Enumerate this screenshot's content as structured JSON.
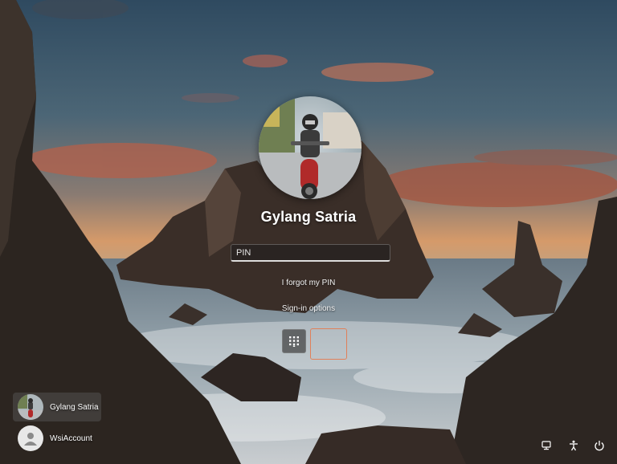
{
  "user": {
    "name": "Gylang Satria"
  },
  "pin": {
    "placeholder": "PIN",
    "value": ""
  },
  "links": {
    "forgot": "I forgot my PIN",
    "signin_options": "Sign-in options"
  },
  "signin_methods": [
    {
      "name": "PIN keypad",
      "icon": "keypad-icon"
    },
    {
      "name": "selected option",
      "icon": ""
    }
  ],
  "users": [
    {
      "name": "Gylang Satria",
      "icon": "user-photo"
    },
    {
      "name": "WsiAccount",
      "icon": "person-icon"
    }
  ],
  "system_buttons": [
    {
      "name": "network",
      "icon": "network-icon"
    },
    {
      "name": "accessibility",
      "icon": "accessibility-icon"
    },
    {
      "name": "power",
      "icon": "power-icon"
    }
  ],
  "colors": {
    "focus_outline": "#e0805a"
  }
}
